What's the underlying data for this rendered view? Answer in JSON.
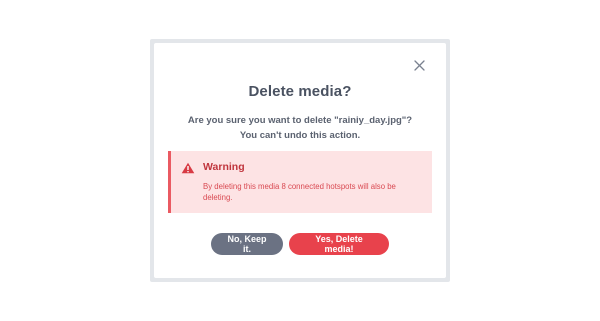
{
  "dialog": {
    "title": "Delete media?",
    "message": "Are you sure you want to delete \"rainiy_day.jpg\"? You can't undo this action.",
    "close_icon": "close-icon",
    "warning": {
      "icon": "warning-triangle-icon",
      "title": "Warning",
      "text": "By deleting this media 8 connected hotspots will also be deleting."
    },
    "buttons": {
      "keep_label": "No, Keep it.",
      "delete_label": "Yes, Delete media!"
    }
  },
  "colors": {
    "title": "#4a5261",
    "warning_bg": "#fde3e4",
    "warning_accent": "#ea5a62",
    "warning_title": "#c0353d",
    "keep_button": "#6b7283",
    "delete_button": "#e8424c"
  }
}
